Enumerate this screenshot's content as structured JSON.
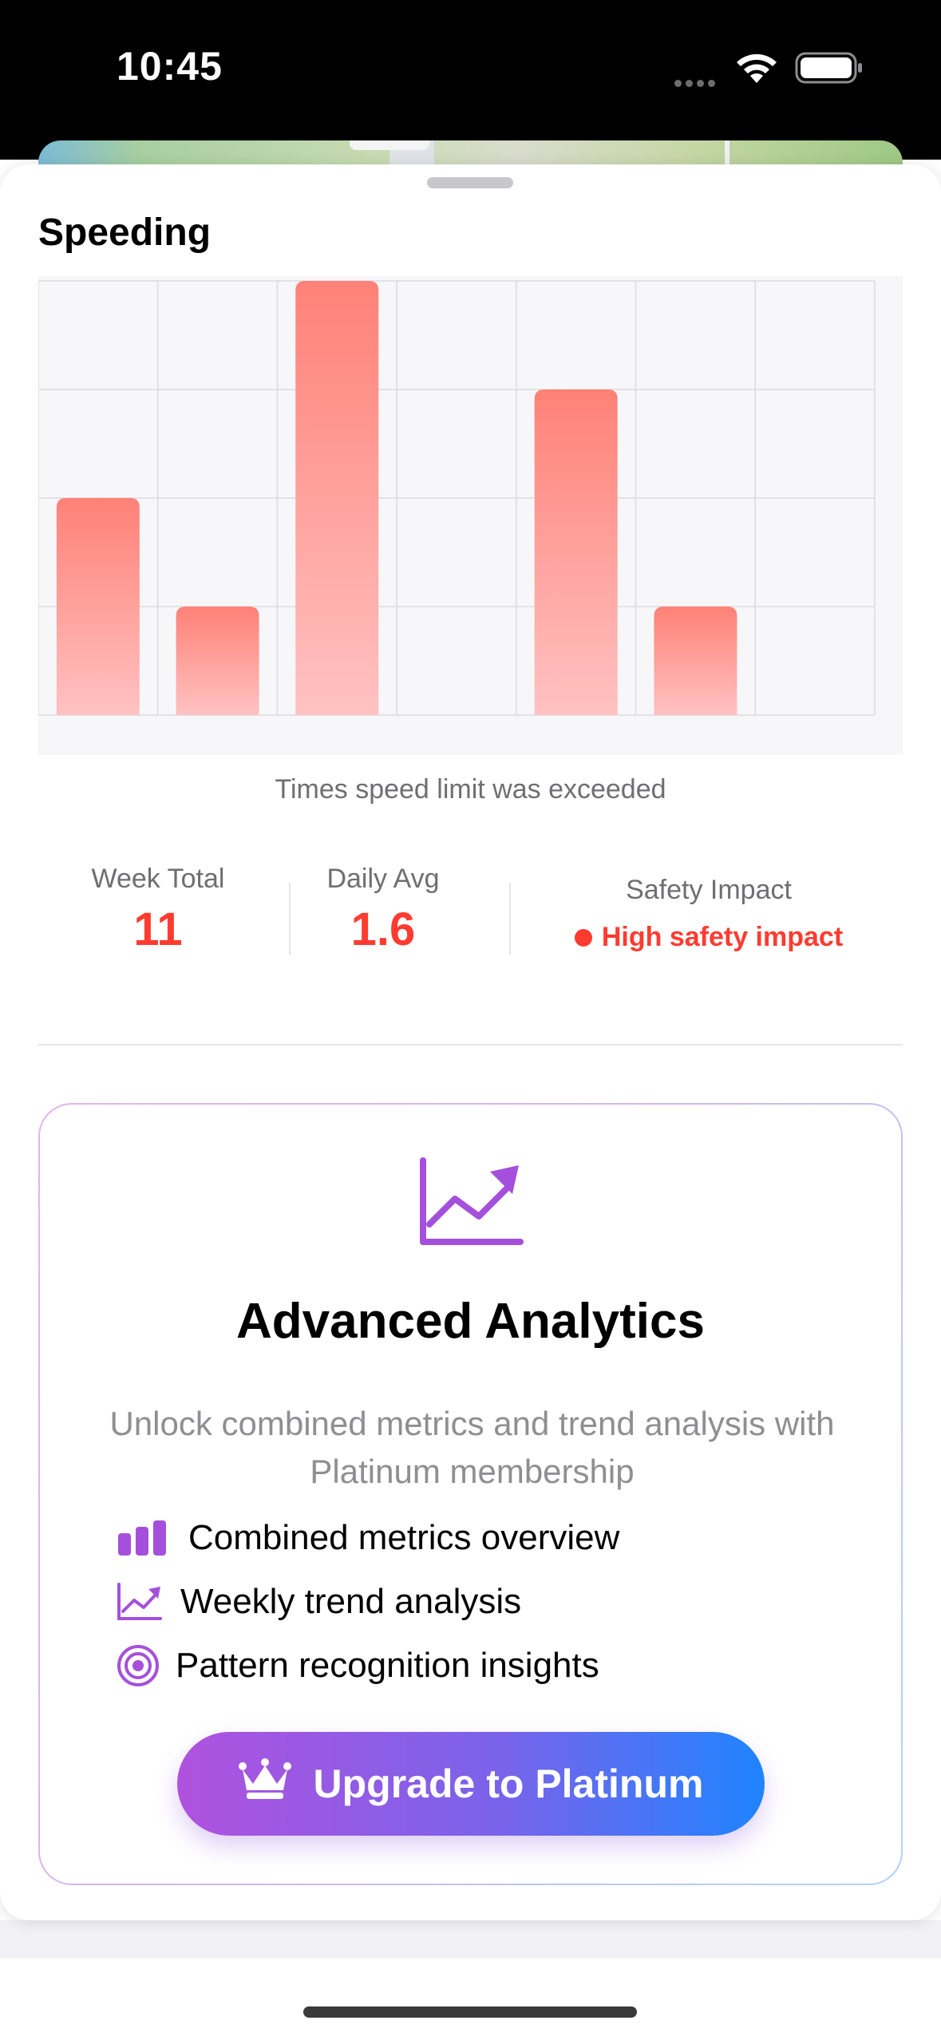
{
  "status_bar": {
    "time": "10:45",
    "icons": [
      "cellular-dots-icon",
      "wifi-icon",
      "battery-icon"
    ]
  },
  "sheet": {
    "title": "Speeding"
  },
  "chart_data": {
    "type": "bar",
    "title": "",
    "categories": [
      "",
      "",
      "",
      "",
      "",
      "",
      ""
    ],
    "values": [
      2,
      1,
      4,
      0,
      3,
      1,
      0
    ],
    "ylim": [
      0,
      4
    ],
    "grid": true,
    "bar_color_top": "#ff8177",
    "bar_color_bottom": "#ffc2c2",
    "caption": "Times speed limit was exceeded"
  },
  "stats": {
    "week_total": {
      "label": "Week Total",
      "value": "11"
    },
    "daily_avg": {
      "label": "Daily Avg",
      "value": "1.6"
    },
    "safety_impact": {
      "label": "Safety Impact",
      "value": "High safety impact"
    }
  },
  "promo": {
    "icon": "trend-chart-icon",
    "title": "Advanced Analytics",
    "subtitle": "Unlock combined metrics and trend analysis with Platinum membership",
    "features": [
      {
        "icon": "bar-chart-icon",
        "label": "Combined metrics overview"
      },
      {
        "icon": "trend-line-icon",
        "label": "Weekly trend analysis"
      },
      {
        "icon": "target-icon",
        "label": "Pattern recognition insights"
      }
    ],
    "button_label": "Upgrade to Platinum",
    "button_icon": "crown-icon"
  },
  "colors": {
    "accent_red": "#ff3b30",
    "accent_purple": "#af52de",
    "accent_blue": "#1f84ff"
  }
}
